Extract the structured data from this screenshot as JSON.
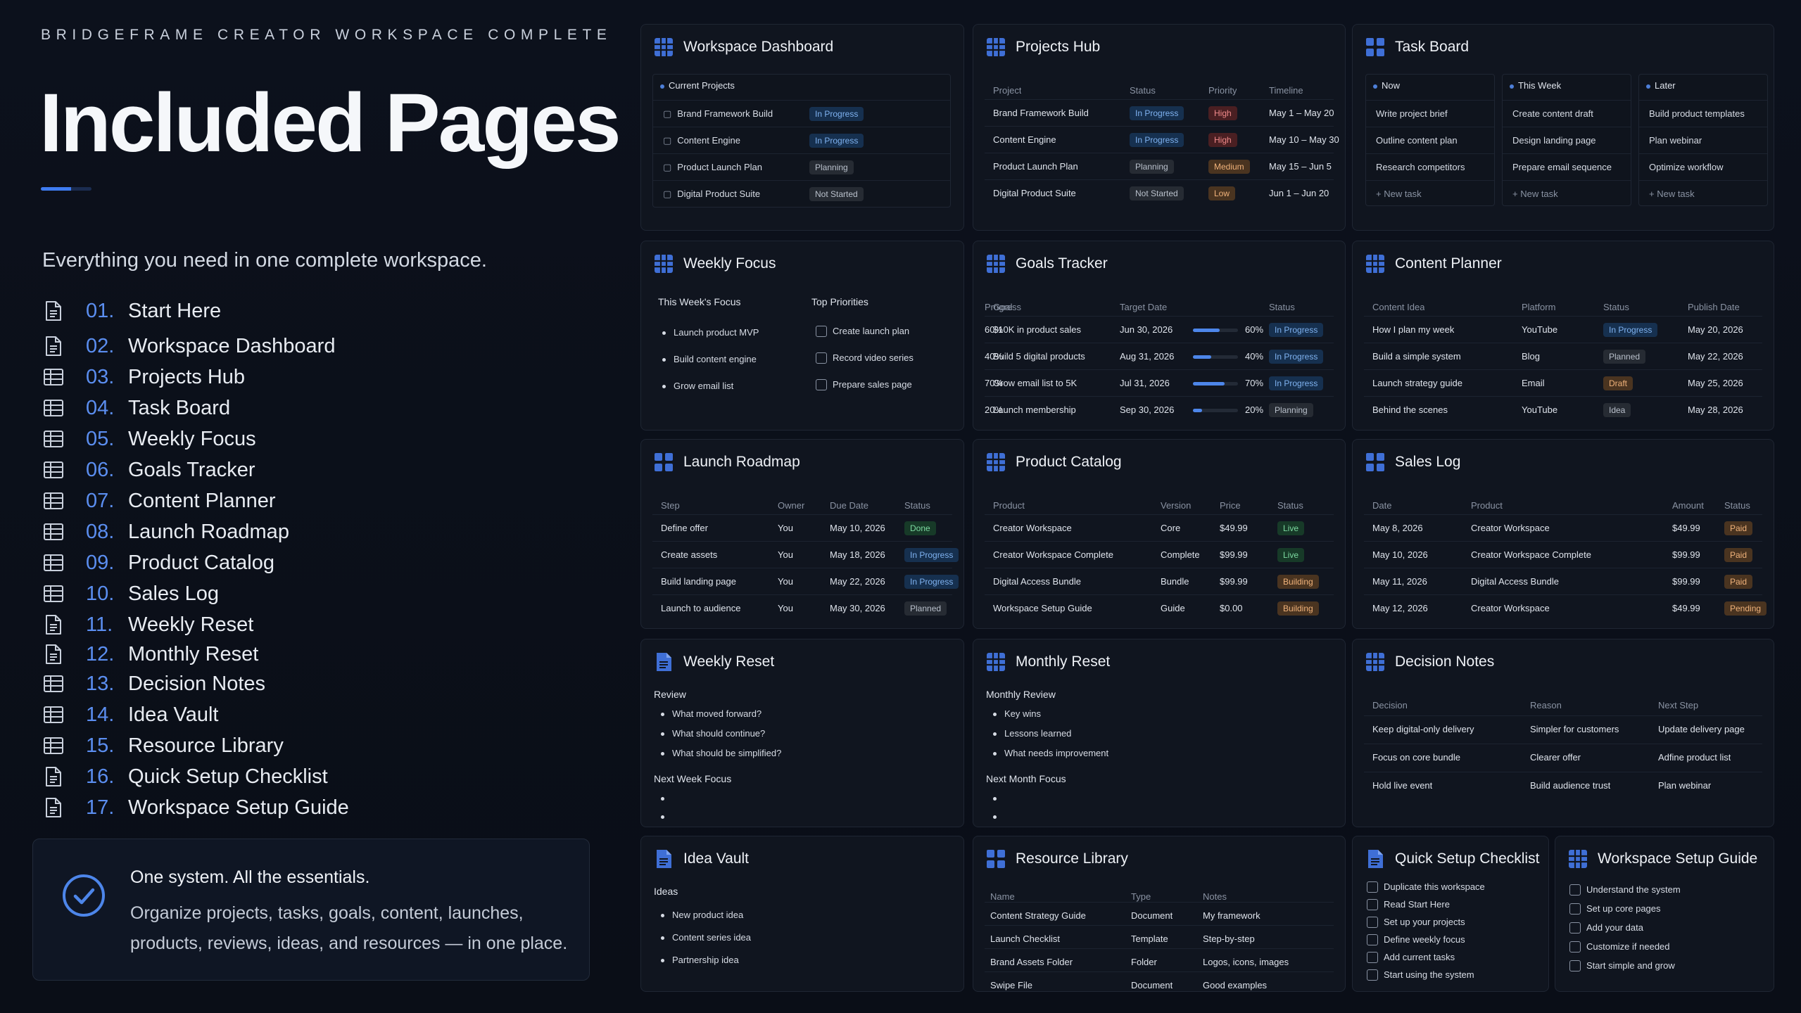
{
  "brand": "BRIDGEFRAME CREATOR WORKSPACE COMPLETE",
  "title": "Included Pages",
  "subtitle": "Everything you need in one complete workspace.",
  "pages": [
    {
      "num": "01.",
      "label": "Start Here",
      "icon": "page-icon"
    },
    {
      "num": "02.",
      "label": "Workspace Dashboard",
      "icon": "page-icon"
    },
    {
      "num": "03.",
      "label": "Projects Hub",
      "icon": "table-icon"
    },
    {
      "num": "04.",
      "label": "Task Board",
      "icon": "table-icon"
    },
    {
      "num": "05.",
      "label": "Weekly Focus",
      "icon": "table-icon"
    },
    {
      "num": "06.",
      "label": "Goals Tracker",
      "icon": "table-icon"
    },
    {
      "num": "07.",
      "label": "Content Planner",
      "icon": "table-icon"
    },
    {
      "num": "08.",
      "label": "Launch Roadmap",
      "icon": "table-icon"
    },
    {
      "num": "09.",
      "label": "Product Catalog",
      "icon": "table-icon"
    },
    {
      "num": "10.",
      "label": "Sales Log",
      "icon": "table-icon"
    },
    {
      "num": "11.",
      "label": "Weekly Reset",
      "icon": "page-icon"
    },
    {
      "num": "12.",
      "label": "Monthly Reset",
      "icon": "page-icon"
    },
    {
      "num": "13.",
      "label": "Decision Notes",
      "icon": "table-icon"
    },
    {
      "num": "14.",
      "label": "Idea Vault",
      "icon": "table-icon"
    },
    {
      "num": "15.",
      "label": "Resource Library",
      "icon": "table-icon"
    },
    {
      "num": "16.",
      "label": "Quick Setup Checklist",
      "icon": "page-icon"
    },
    {
      "num": "17.",
      "label": "Workspace Setup Guide",
      "icon": "page-icon"
    }
  ],
  "callout": {
    "headline": "One system. All the essentials.",
    "body": "Organize projects, tasks, goals, content, launches, products, reviews, ideas, and resources — in one place."
  },
  "colors": {
    "accent": "#3e7bf0",
    "number": "#5b8ef0",
    "bg": "#0b0f18",
    "card": "#10151f"
  },
  "dashboard": {
    "title": "Workspace Dashboard",
    "section": "Current Projects",
    "rows": [
      [
        "Brand Framework Build",
        "In Progress"
      ],
      [
        "Content Engine",
        "In Progress"
      ],
      [
        "Product Launch Plan",
        "Planning"
      ],
      [
        "Digital Product Suite",
        "Not Started"
      ]
    ]
  },
  "projects": {
    "title": "Projects Hub",
    "headers": [
      "Project",
      "Status",
      "Priority",
      "Timeline"
    ],
    "rows": [
      [
        "Brand Framework Build",
        "In Progress",
        "High",
        "May 1 – May 20"
      ],
      [
        "Content Engine",
        "In Progress",
        "High",
        "May 10 – May 30"
      ],
      [
        "Product Launch Plan",
        "Planning",
        "Medium",
        "May 15 – Jun 5"
      ],
      [
        "Digital Product Suite",
        "Not Started",
        "Low",
        "Jun 1 – Jun 20"
      ]
    ]
  },
  "taskboard": {
    "title": "Task Board",
    "columns": [
      {
        "name": "Now",
        "tasks": [
          "Write project brief",
          "Outline content plan",
          "Research competitors"
        ],
        "new": "+ New task"
      },
      {
        "name": "This Week",
        "tasks": [
          "Create content draft",
          "Design landing page",
          "Prepare email sequence"
        ],
        "new": "+ New task"
      },
      {
        "name": "Later",
        "tasks": [
          "Build product templates",
          "Plan webinar",
          "Optimize workflow"
        ],
        "new": "+ New task"
      }
    ]
  },
  "weekly": {
    "title": "Weekly Focus",
    "left_head": "This Week's Focus",
    "right_head": "Top Priorities",
    "focus": [
      "Launch product MVP",
      "Build content engine",
      "Grow email list"
    ],
    "priorities": [
      "Create launch plan",
      "Record video series",
      "Prepare sales page"
    ]
  },
  "goals": {
    "title": "Goals Tracker",
    "headers": [
      "Goal",
      "Target Date",
      "Progress",
      "Status"
    ],
    "rows": [
      [
        "$10K in product sales",
        "Jun 30, 2026",
        "60%",
        "In Progress",
        60
      ],
      [
        "Build 5 digital products",
        "Aug 31, 2026",
        "40%",
        "In Progress",
        40
      ],
      [
        "Grow email list to 5K",
        "Jul 31, 2026",
        "70%",
        "In Progress",
        70
      ],
      [
        "Launch membership",
        "Sep 30, 2026",
        "20%",
        "Planning",
        20
      ]
    ]
  },
  "content": {
    "title": "Content Planner",
    "headers": [
      "Content Idea",
      "Platform",
      "Status",
      "Publish Date"
    ],
    "rows": [
      [
        "How I plan my week",
        "YouTube",
        "In Progress",
        "May 20, 2026"
      ],
      [
        "Build a simple system",
        "Blog",
        "Planned",
        "May 22, 2026"
      ],
      [
        "Launch strategy guide",
        "Email",
        "Draft",
        "May 25, 2026"
      ],
      [
        "Behind the scenes",
        "YouTube",
        "Idea",
        "May 28, 2026"
      ]
    ]
  },
  "roadmap": {
    "title": "Launch Roadmap",
    "headers": [
      "Step",
      "Owner",
      "Due Date",
      "Status"
    ],
    "rows": [
      [
        "Define offer",
        "You",
        "May 10, 2026",
        "Done"
      ],
      [
        "Create assets",
        "You",
        "May 18, 2026",
        "In Progress"
      ],
      [
        "Build landing page",
        "You",
        "May 22, 2026",
        "In Progress"
      ],
      [
        "Launch to audience",
        "You",
        "May 30, 2026",
        "Planned"
      ]
    ]
  },
  "catalog": {
    "title": "Product Catalog",
    "headers": [
      "Product",
      "Version",
      "Price",
      "Status"
    ],
    "rows": [
      [
        "Creator Workspace",
        "Core",
        "$49.99",
        "Live"
      ],
      [
        "Creator Workspace Complete",
        "Complete",
        "$99.99",
        "Live"
      ],
      [
        "Digital Access Bundle",
        "Bundle",
        "$99.99",
        "Building"
      ],
      [
        "Workspace Setup Guide",
        "Guide",
        "$0.00",
        "Building"
      ]
    ]
  },
  "sales": {
    "title": "Sales Log",
    "headers": [
      "Date",
      "Product",
      "Amount",
      "Status"
    ],
    "rows": [
      [
        "May 8, 2026",
        "Creator Workspace",
        "$49.99",
        "Paid"
      ],
      [
        "May 10, 2026",
        "Creator Workspace Complete",
        "$99.99",
        "Paid"
      ],
      [
        "May 11, 2026",
        "Digital Access Bundle",
        "$99.99",
        "Paid"
      ],
      [
        "May 12, 2026",
        "Creator Workspace",
        "$49.99",
        "Pending"
      ]
    ]
  },
  "wreset": {
    "title": "Weekly Reset",
    "review": "Review",
    "items": [
      "What moved forward?",
      "What should continue?",
      "What should be simplified?"
    ],
    "next": "Next Week Focus"
  },
  "mreset": {
    "title": "Monthly Reset",
    "review": "Monthly Review",
    "items": [
      "Key wins",
      "Lessons learned",
      "What needs improvement"
    ],
    "next": "Next Month Focus"
  },
  "decision": {
    "title": "Decision Notes",
    "headers": [
      "Decision",
      "Reason",
      "Next Step"
    ],
    "rows": [
      [
        "Keep digital-only delivery",
        "Simpler for customers",
        "Update delivery page"
      ],
      [
        "Focus on core bundle",
        "Clearer offer",
        "Adfine product list"
      ],
      [
        "Hold live event",
        "Build audience trust",
        "Plan webinar"
      ]
    ]
  },
  "ideas": {
    "title": "Idea Vault",
    "section": "Ideas",
    "items": [
      "New product idea",
      "Content series idea",
      "Partnership idea"
    ]
  },
  "resources": {
    "title": "Resource Library",
    "headers": [
      "Name",
      "Type",
      "Notes"
    ],
    "rows": [
      [
        "Content Strategy Guide",
        "Document",
        "My framework"
      ],
      [
        "Launch Checklist",
        "Template",
        "Step-by-step"
      ],
      [
        "Brand Assets Folder",
        "Folder",
        "Logos, icons, images"
      ],
      [
        "Swipe File",
        "Document",
        "Good examples"
      ]
    ]
  },
  "quick": {
    "title": "Quick Setup Checklist",
    "items": [
      "Duplicate this workspace",
      "Read Start Here",
      "Set up your projects",
      "Define weekly focus",
      "Add current tasks",
      "Start using the system"
    ]
  },
  "guide": {
    "title": "Workspace Setup Guide",
    "items": [
      "Understand the system",
      "Set up core pages",
      "Add your data",
      "Customize if needed",
      "Start simple and grow"
    ]
  }
}
